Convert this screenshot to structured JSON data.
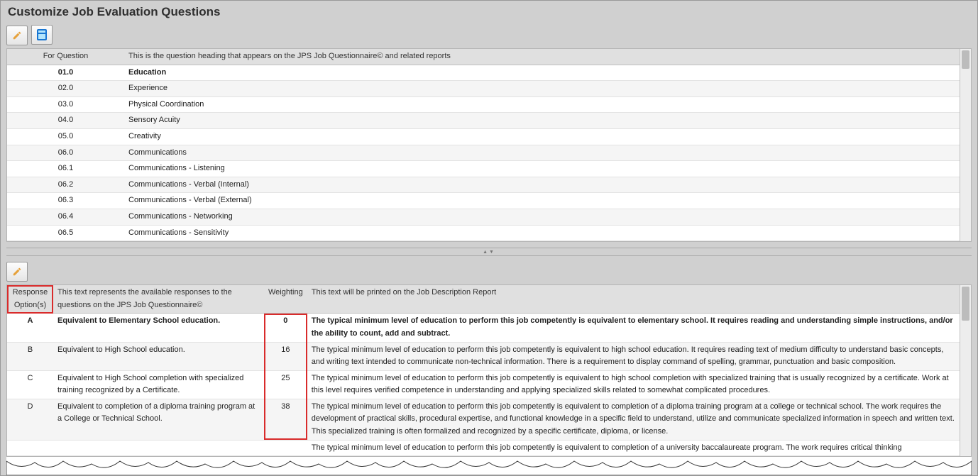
{
  "title": "Customize Job Evaluation Questions",
  "upper": {
    "header": {
      "col1": "For Question",
      "col2": "This is the question heading that appears on the JPS Job Questionnaire© and related reports"
    },
    "rows": [
      {
        "code": "01.0",
        "text": "Education",
        "selected": true
      },
      {
        "code": "02.0",
        "text": "Experience"
      },
      {
        "code": "03.0",
        "text": "Physical Coordination"
      },
      {
        "code": "04.0",
        "text": "Sensory Acuity"
      },
      {
        "code": "05.0",
        "text": "Creativity"
      },
      {
        "code": "06.0",
        "text": "Communications"
      },
      {
        "code": "06.1",
        "text": "Communications - Listening"
      },
      {
        "code": "06.2",
        "text": "Communications - Verbal (Internal)"
      },
      {
        "code": "06.3",
        "text": "Communications - Verbal (External)"
      },
      {
        "code": "06.4",
        "text": "Communications - Networking"
      },
      {
        "code": "06.5",
        "text": "Communications - Sensitivity"
      }
    ]
  },
  "lower": {
    "header": {
      "opt": "Response Option(s)",
      "resp": "This text represents the available responses to the questions on the JPS Job Questionnaire©",
      "wt": "Weighting",
      "desc": "This text will be printed on the Job Description Report"
    },
    "rows": [
      {
        "opt": "A",
        "resp": "Equivalent to Elementary School education.",
        "wt": "0",
        "desc": "The typical minimum level of education to perform this job competently is equivalent to elementary school. It requires reading and understanding simple instructions, and/or the ability to count, add and subtract.",
        "selected": true
      },
      {
        "opt": "B",
        "resp": "Equivalent to High School education.",
        "wt": "16",
        "desc": "The typical minimum level of education to perform this job competently is equivalent to high school education. It requires reading text of medium difficulty to understand basic concepts, and writing text intended to communicate non-technical information.  There is a requirement to display command of spelling, grammar, punctuation and basic composition."
      },
      {
        "opt": "C",
        "resp": "Equivalent to High School completion with specialized training recognized by a Certificate.",
        "wt": "25",
        "desc": "The typical minimum level of education to perform this job competently is equivalent to high school completion with specialized training that is usually recognized by a certificate. Work at this level requires verified competence in understanding and applying specialized skills related to somewhat complicated procedures."
      },
      {
        "opt": "D",
        "resp": "Equivalent to completion of a diploma training program at a College or Technical School.",
        "wt": "38",
        "desc": "The typical minimum level of education to perform this job competently is equivalent to completion of a diploma training program at a college or technical school.  The work requires the development of practical skills, procedural expertise, and functional knowledge in a specific field to understand, utilize and communicate specialized information in speech and written text. This specialized training is often formalized and recognized by a specific certificate, diploma, or license."
      },
      {
        "opt": "",
        "resp": "",
        "wt": "",
        "desc": "The typical minimum level of education to perform this job competently is equivalent to completion of a university baccalaureate program.  The work requires critical thinking"
      }
    ]
  }
}
